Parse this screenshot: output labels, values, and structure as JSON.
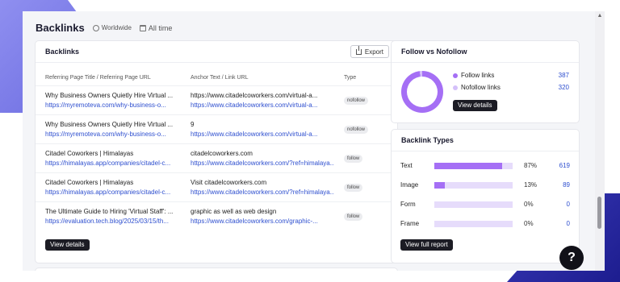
{
  "header": {
    "title": "Backlinks",
    "scope": "Worldwide",
    "period": "All time"
  },
  "backlinks": {
    "title": "Backlinks",
    "export_label": "Export",
    "columns": [
      "Referring Page Title / Referring Page URL",
      "Anchor Text / Link URL",
      "Type"
    ],
    "rows": [
      {
        "title": "Why Business Owners Quietly Hire Virtual ...",
        "url": "https://myremoteva.com/why-business-o...",
        "anchor": "https://www.citadelcoworkers.com/virtual-a...",
        "link": "https://www.citadelcoworkers.com/virtual-a...",
        "type": "nofollow"
      },
      {
        "title": "Why Business Owners Quietly Hire Virtual ...",
        "url": "https://myremoteva.com/why-business-o...",
        "anchor": "9",
        "link": "https://www.citadelcoworkers.com/virtual-a...",
        "type": "nofollow"
      },
      {
        "title": "Citadel Coworkers | Himalayas",
        "url": "https://himalayas.app/companies/citadel-c...",
        "anchor": "citadelcoworkers.com",
        "link": "https://www.citadelcoworkers.com/?ref=himalaya...",
        "type": "follow"
      },
      {
        "title": "Citadel Coworkers | Himalayas",
        "url": "https://himalayas.app/companies/citadel-c...",
        "anchor": "Visit citadelcoworkers.com",
        "link": "https://www.citadelcoworkers.com/?ref=himalaya...",
        "type": "follow"
      },
      {
        "title": "The Ultimate Guide to Hiring 'Virtual Staff': ...",
        "url": "https://evaluation.tech.blog/2025/03/15/th...",
        "anchor": "graphic as well as web design",
        "link": "https://www.citadelcoworkers.com/graphic-...",
        "type": "follow"
      }
    ],
    "view_details_label": "View details"
  },
  "follow": {
    "title": "Follow vs Nofollow",
    "items": [
      {
        "label": "Follow links",
        "value": "387",
        "color": "#a56ff5"
      },
      {
        "label": "Nofollow links",
        "value": "320",
        "color": "#d4c0fa"
      }
    ],
    "view_details_label": "View details"
  },
  "types": {
    "title": "Backlink Types",
    "items": [
      {
        "label": "Text",
        "pct": "87%",
        "count": "619",
        "fraction": 0.87
      },
      {
        "label": "Image",
        "pct": "13%",
        "count": "89",
        "fraction": 0.13
      },
      {
        "label": "Form",
        "pct": "0%",
        "count": "0",
        "fraction": 0
      },
      {
        "label": "Frame",
        "pct": "0%",
        "count": "0",
        "fraction": 0
      }
    ],
    "view_report_label": "View full report"
  },
  "help": {
    "label": "?"
  },
  "colors": {
    "accent": "#a56ff5",
    "accent_light": "#d4c0fa",
    "link": "#2e4fcf"
  }
}
